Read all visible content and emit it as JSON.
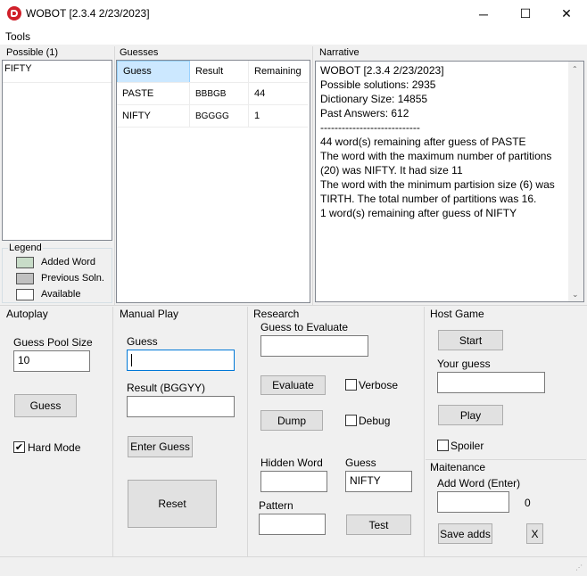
{
  "window": {
    "title": "WOBOT [2.3.4 2/23/2023]",
    "minimize_glyph": "─",
    "maximize_glyph": "☐",
    "close_glyph": "✕"
  },
  "menu": {
    "tools_label": "Tools"
  },
  "possible": {
    "header": "Possible (1)",
    "items": [
      "FIFTY"
    ]
  },
  "legend": {
    "header": "Legend",
    "items": [
      {
        "label": "Added Word",
        "color": "#c8dcc8"
      },
      {
        "label": "Previous Soln.",
        "color": "#c0c0c0"
      },
      {
        "label": "Available",
        "color": "#ffffff"
      }
    ]
  },
  "guesses": {
    "header": "Guesses",
    "columns": [
      "Guess",
      "Result",
      "Remaining"
    ],
    "rows": [
      [
        "PASTE",
        "BBBGB",
        "44"
      ],
      [
        "NIFTY",
        "BGGGG",
        "1"
      ]
    ],
    "header_selected_color": "#cce8ff"
  },
  "narrative": {
    "header": "Narrative",
    "lines": [
      "WOBOT [2.3.4 2/23/2023]",
      "Possible solutions: 2935",
      "Dictionary Size: 14855",
      "Past Answers: 612",
      "----------------------------",
      "44 word(s) remaining after guess of PASTE",
      "The word with the maximum number of partitions (20) was NIFTY. It had size 11",
      "The word with the minimum partision size (6) was TIRTH. The total number of partitions was 16.",
      "1 word(s) remaining after guess of NIFTY"
    ]
  },
  "autoplay": {
    "header": "Autoplay",
    "pool_label": "Guess Pool Size",
    "pool_value": "10",
    "guess_button": "Guess",
    "hard_mode_label": "Hard Mode",
    "hard_mode_checked": true
  },
  "manual": {
    "header": "Manual Play",
    "guess_label": "Guess",
    "guess_value": "",
    "result_label": "Result (BGGYY)",
    "result_value": "",
    "enter_button": "Enter Guess",
    "reset_button": "Reset"
  },
  "research": {
    "header": "Research",
    "evaluate_label": "Guess to Evaluate",
    "evaluate_value": "",
    "evaluate_button": "Evaluate",
    "verbose_label": "Verbose",
    "dump_button": "Dump",
    "debug_label": "Debug",
    "hidden_word_label": "Hidden Word",
    "hidden_word_value": "",
    "guess_label": "Guess",
    "guess_value": "NIFTY",
    "pattern_label": "Pattern",
    "pattern_value": "",
    "test_button": "Test"
  },
  "host": {
    "header": "Host Game",
    "start_button": "Start",
    "your_guess_label": "Your guess",
    "your_guess_value": "",
    "play_button": "Play",
    "spoiler_label": "Spoiler"
  },
  "maintenance": {
    "header": "Maitenance",
    "add_word_label": "Add Word (Enter)",
    "add_word_value": "",
    "count_value": "0",
    "save_button": "Save adds",
    "close_button": "X"
  }
}
